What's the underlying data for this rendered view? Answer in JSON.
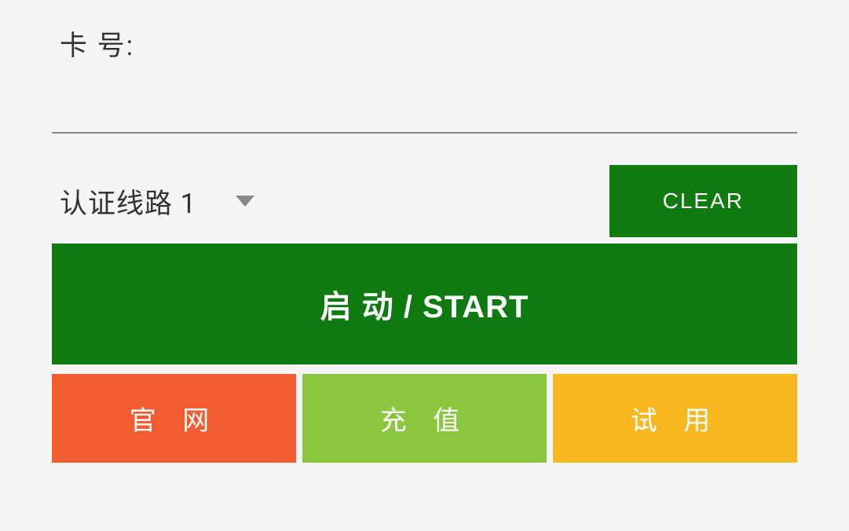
{
  "card_number": {
    "label": "卡 号:",
    "value": ""
  },
  "auth_line": {
    "selected": "认证线路 1"
  },
  "buttons": {
    "clear": "CLEAR",
    "start": "启 动 / START",
    "website": "官 网",
    "recharge": "充 值",
    "trial": "试 用"
  },
  "colors": {
    "primary_green": "#0f7a0f",
    "orange": "#f25c2e",
    "light_green": "#8bc63f",
    "amber": "#f7b81f"
  }
}
